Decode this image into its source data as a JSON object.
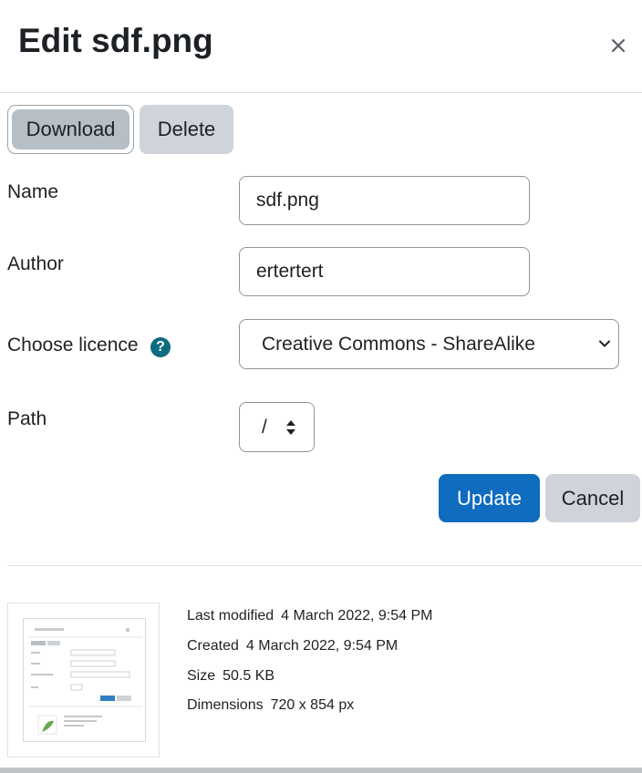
{
  "dialog": {
    "title": "Edit sdf.png",
    "close_icon": "close-icon"
  },
  "actions": {
    "download_label": "Download",
    "delete_label": "Delete"
  },
  "form": {
    "name_label": "Name",
    "name_value": "sdf.png",
    "author_label": "Author",
    "author_value": "ertertert",
    "licence_label": "Choose licence",
    "licence_help_icon": "question-circle-icon",
    "licence_value": "Creative Commons - ShareAlike",
    "path_label": "Path",
    "path_value": "/"
  },
  "buttons": {
    "update_label": "Update",
    "cancel_label": "Cancel"
  },
  "file_info": {
    "last_modified_label": "Last modified",
    "last_modified_value": "4 March 2022, 9:54 PM",
    "created_label": "Created",
    "created_value": "4 March 2022, 9:54 PM",
    "size_label": "Size",
    "size_value": "50.5 KB",
    "dimensions_label": "Dimensions",
    "dimensions_value": "720 x 854 px"
  },
  "colors": {
    "primary": "#0f6cbf",
    "secondary": "#ced4da",
    "help_icon": "#0f6b7f"
  }
}
